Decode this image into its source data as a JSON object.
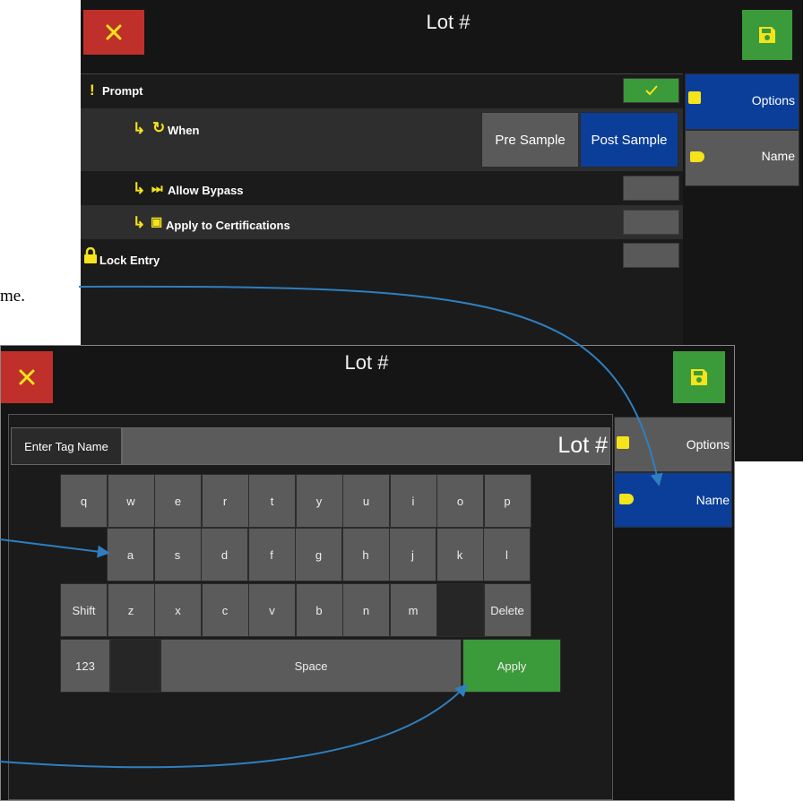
{
  "top_window": {
    "title": "Lot #",
    "rows": {
      "prompt": "Prompt",
      "when": "When",
      "allow_bypass": "Allow Bypass",
      "apply_to_certifications": "Apply to Certifications",
      "lock_entry": "Lock Entry"
    },
    "when_options": [
      "Pre Sample",
      "Post Sample"
    ],
    "when_selected": "Post Sample",
    "prompt_checked": true,
    "side_tabs": {
      "options": "Options",
      "name": "Name"
    },
    "active_tab": "Options"
  },
  "callout": {
    "text": "me."
  },
  "bottom_window": {
    "title": "Lot #",
    "tag_label": "Enter Tag Name",
    "tag_value": "Lot #",
    "keyboard": {
      "row1": [
        "q",
        "w",
        "e",
        "r",
        "t",
        "y",
        "u",
        "i",
        "o",
        "p"
      ],
      "row2": [
        "a",
        "s",
        "d",
        "f",
        "g",
        "h",
        "j",
        "k",
        "l"
      ],
      "row3": [
        "Shift",
        "z",
        "x",
        "c",
        "v",
        "b",
        "n",
        "m",
        "",
        "Delete"
      ],
      "row4": {
        "numbers": "123",
        "space": "Space",
        "apply": "Apply"
      }
    },
    "side_tabs": {
      "options": "Options",
      "name": "Name"
    },
    "active_tab": "Name"
  },
  "colors": {
    "cancel": "#c0302b",
    "save": "#3b9a3a",
    "active_blue": "#0a3e99",
    "accent_yellow": "#f5e31c",
    "arrow_blue": "#2f7fc0"
  }
}
